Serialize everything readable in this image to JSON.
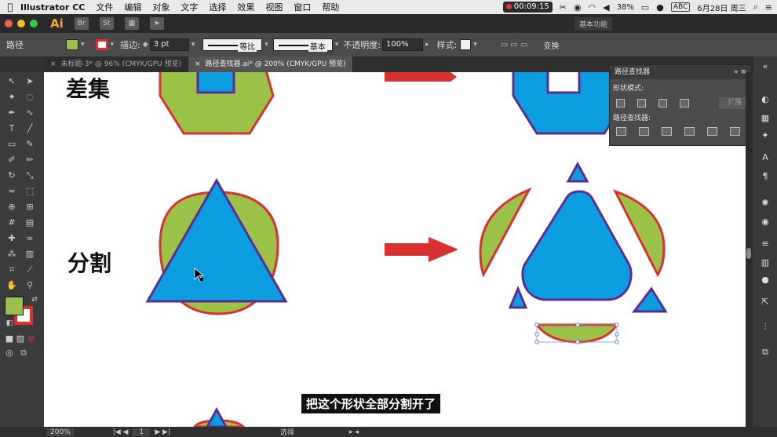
{
  "menubar": {
    "app_name": "Illustrator CC",
    "items": [
      "文件",
      "编辑",
      "对象",
      "文字",
      "选择",
      "效果",
      "视图",
      "窗口",
      "帮助"
    ],
    "record_time": "00:09:15",
    "battery": "38%",
    "input_method": "ABC",
    "date": "6月28日 周三"
  },
  "appbar": {
    "logo": "Ai",
    "br_icon": "Br",
    "st_icon": "St",
    "workspace": "基本功能"
  },
  "control": {
    "selection_label": "路径",
    "stroke_label": "描边:",
    "stroke_weight": "3 pt",
    "profile_label": "等比",
    "brush_label": "基本",
    "opacity_label": "不透明度:",
    "opacity_value": "100%",
    "style_label": "样式:",
    "transform_label": "变换",
    "colors": {
      "fill": "#9cc148",
      "stroke": "#d93030",
      "shape_blue": "#0c9de0",
      "shape_purple": "#5a2d91"
    }
  },
  "tabs": [
    {
      "label": "未标题-3* @ 96% (CMYK/GPU 预览)",
      "active": false
    },
    {
      "label": "路径查找器.ai* @ 200% (CMYK/GPU 预览)",
      "active": true
    }
  ],
  "canvas": {
    "heading_minus": "差集",
    "heading_divide": "分割",
    "subtitle": "把这个形状全部分割开了"
  },
  "pathfinder": {
    "title": "路径查找器",
    "shape_modes_label": "形状模式:",
    "expand_label": "扩展",
    "pathfinders_label": "路径查找器:"
  },
  "status": {
    "zoom": "200%",
    "page": "1",
    "tool": "选择"
  }
}
